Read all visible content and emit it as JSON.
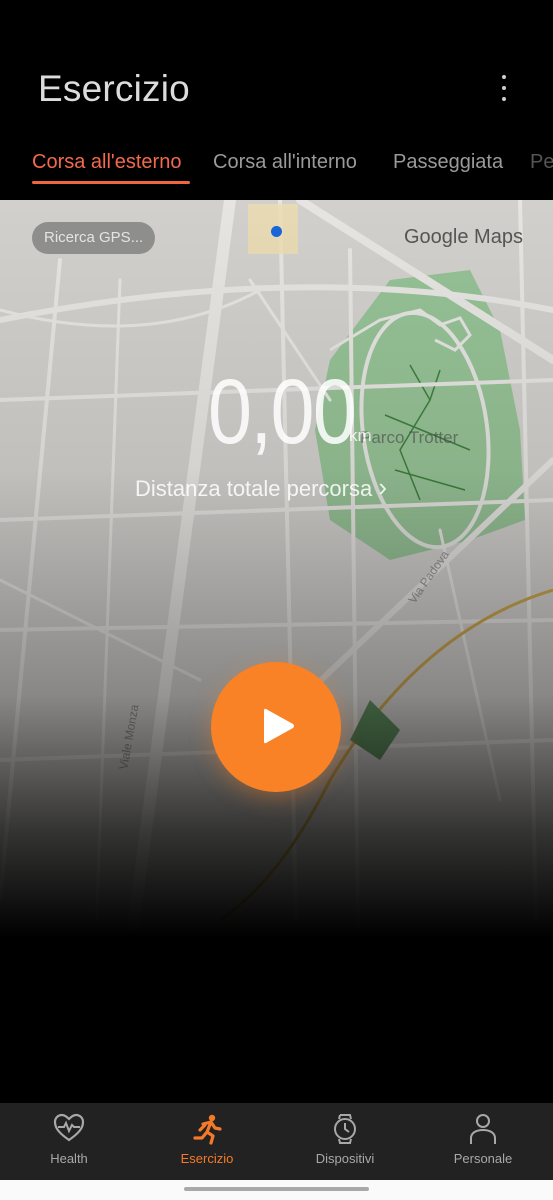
{
  "header": {
    "title": "Esercizio",
    "more_icon": "more-vertical-icon"
  },
  "tabs": [
    {
      "label": "Corsa all'esterno",
      "active": true
    },
    {
      "label": "Corsa all'interno",
      "active": false
    },
    {
      "label": "Passeggiata",
      "active": false
    },
    {
      "label": "Pe",
      "active": false
    }
  ],
  "map": {
    "gps_status": "Ricerca GPS...",
    "provider": "Google Maps",
    "labels": {
      "park": "Parco Trotter",
      "street_1": "Via Padova",
      "street_2": "Viale Monza"
    },
    "colors": {
      "background": "#d2d0cd",
      "park": "#8cbf8c",
      "road": "#e8e6e3",
      "location_dot": "#1a66d8"
    }
  },
  "distance": {
    "value": "0,00",
    "unit": "km",
    "link_label": "Distanza totale percorsa",
    "link_chevron": "›"
  },
  "start_button": {
    "icon": "play-icon",
    "color": "#f98226"
  },
  "bottom_nav": {
    "items": [
      {
        "label": "Health",
        "icon": "heart-pulse-icon",
        "active": false
      },
      {
        "label": "Esercizio",
        "icon": "running-icon",
        "active": true
      },
      {
        "label": "Dispositivi",
        "icon": "watch-icon",
        "active": false
      },
      {
        "label": "Personale",
        "icon": "person-icon",
        "active": false
      }
    ],
    "active_color": "#f47a2a"
  }
}
